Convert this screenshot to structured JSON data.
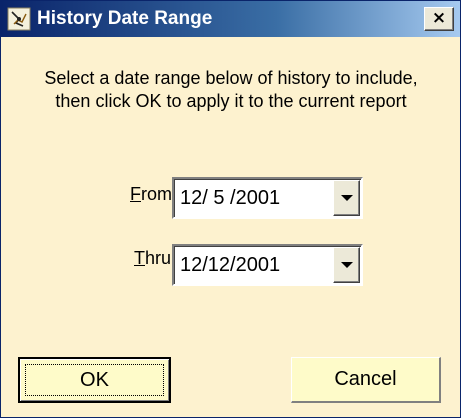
{
  "window": {
    "title": "History Date Range",
    "close_label": "×"
  },
  "instructions": "Select a date range below of history to include, then click OK to apply it to the current report",
  "from": {
    "label_mnemonic": "F",
    "label_rest": "rom:",
    "value": "12/ 5 /2001"
  },
  "thru": {
    "label_mnemonic": "T",
    "label_rest": "hru:",
    "value": "12/12/2001"
  },
  "buttons": {
    "ok": "OK",
    "cancel": "Cancel"
  },
  "icons": {
    "title": "history-app-icon",
    "close": "close-icon",
    "dropdown": "chevron-down-icon"
  },
  "colors": {
    "titlebar": "#0a246a",
    "dialog_background": "#fdf2cf",
    "button_background": "#fefbc9"
  }
}
